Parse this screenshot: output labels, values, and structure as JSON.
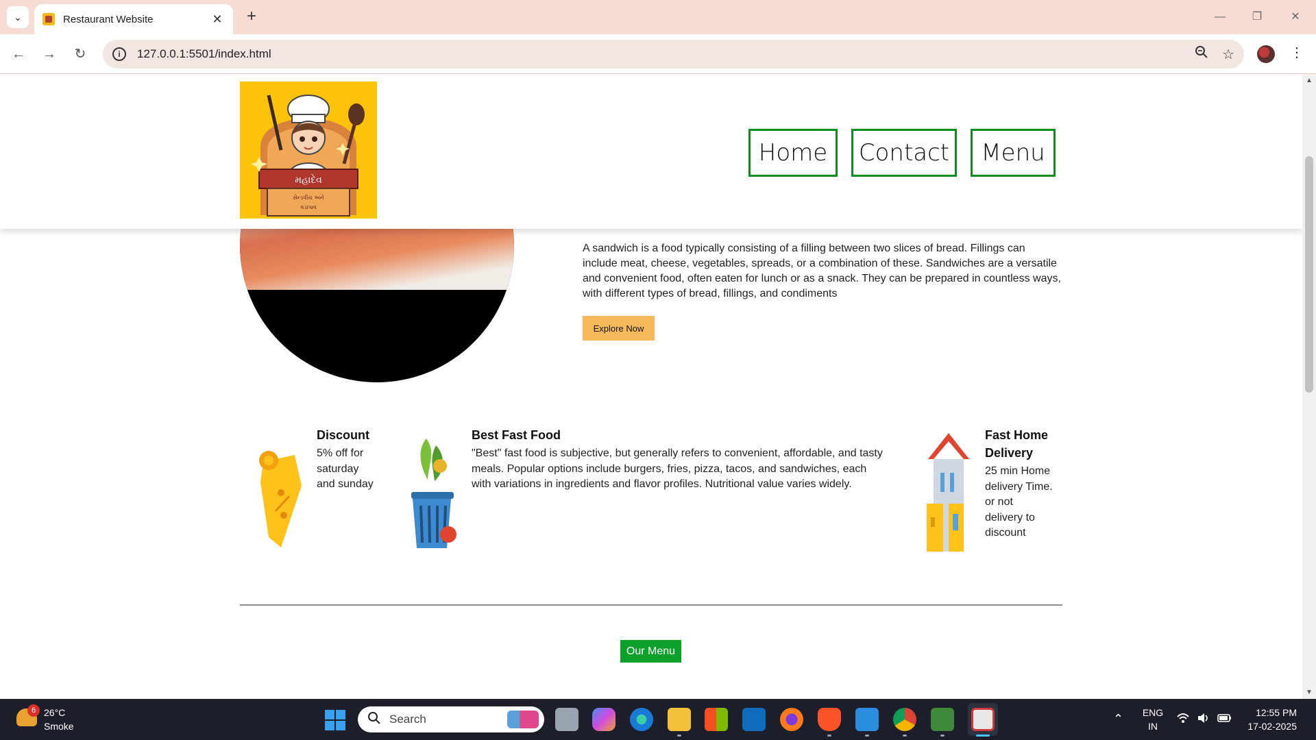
{
  "browser": {
    "tab_title": "Restaurant Website",
    "url": "127.0.0.1:5501/index.html"
  },
  "site": {
    "logo_text_main": "મહાદેવ",
    "logo_text_sub1": "સેન્ડવીચ અને",
    "logo_text_sub2": "વડાપાવ",
    "nav": [
      {
        "label": "Home"
      },
      {
        "label": "Contact"
      },
      {
        "label": "Menu"
      }
    ],
    "hero": {
      "description": "A sandwich is a food typically consisting of a filling between two slices of bread. Fillings can include meat, cheese, vegetables, spreads, or a combination of these. Sandwiches are a versatile and convenient food, often eaten for lunch or as a snack. They can be prepared in countless ways, with different types of bread, fillings, and condiments",
      "button": "Explore Now"
    },
    "features": [
      {
        "title": "Discount",
        "text": "5% off for saturday and sunday",
        "icon": "discount-tag-icon"
      },
      {
        "title": "Best Fast Food",
        "text": "\"Best\" fast food is subjective, but generally refers to convenient, affordable, and tasty meals. Popular options include burgers, fries, pizza, tacos, and sandwiches, each with variations in ingredients and flavor profiles. Nutritional value varies widely.",
        "icon": "grocery-basket-icon"
      },
      {
        "title": "Fast Home Delivery",
        "text": "25 min Home delivery Time. or not delivery to discount",
        "icon": "house-icon"
      }
    ],
    "menu_button": "Our Menu"
  },
  "taskbar": {
    "temperature": "26°C",
    "condition": "Smoke",
    "weather_badge": "6",
    "search_label": "Search",
    "lang_line1": "ENG",
    "lang_line2": "IN",
    "time": "12:55 PM",
    "date": "17-02-2025"
  },
  "colors": {
    "nav_border": "#0a8f1e",
    "explore_button": "#f8b95b",
    "menu_button": "#0ca12a",
    "logo_bg": "#fdc20a"
  }
}
